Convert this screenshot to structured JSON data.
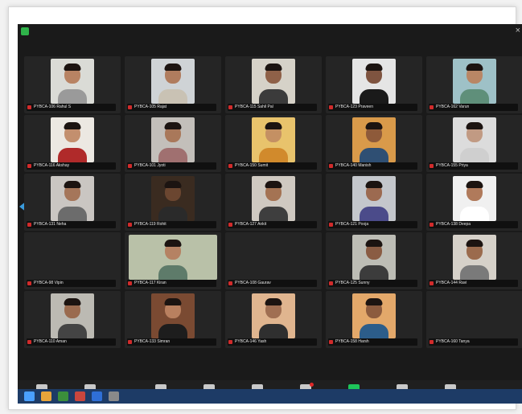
{
  "meeting": {
    "participants": [
      {
        "name": "PYBCA-106 Rahul S",
        "skin": "#b88363",
        "shirt": "#9a9a9a",
        "bg": "#dadbd6",
        "wide": false
      },
      {
        "name": "PYBCA-105 Rajat",
        "skin": "#b07c5e",
        "shirt": "#c9c2b4",
        "bg": "#cfd3d6",
        "wide": false
      },
      {
        "name": "PYBCA-115 Sahil Pal",
        "skin": "#8f6148",
        "shirt": "#3b3b3b",
        "bg": "#d6d2c8",
        "wide": false
      },
      {
        "name": "PYBCA-123 Praveen",
        "skin": "#7f5440",
        "shirt": "#1a1a1a",
        "bg": "#e5e5e5",
        "wide": false
      },
      {
        "name": "PYBCA-162 Varun",
        "skin": "#b98665",
        "shirt": "#5f8f7a",
        "bg": "#9ec1c7",
        "wide": false
      },
      {
        "name": "PYBCA-116 Akshay",
        "skin": "#c38f6e",
        "shirt": "#b02a2a",
        "bg": "#ece8e2",
        "wide": false
      },
      {
        "name": "PYBCA-101 Jyoti",
        "skin": "#a9785a",
        "shirt": "#a07070",
        "bg": "#c3bfba",
        "wide": false
      },
      {
        "name": "PYBCA-150 Sumit",
        "skin": "#c49063",
        "shirt": "#d18a2c",
        "bg": "#e8c36c",
        "wide": false
      },
      {
        "name": "PYBCA-140 Manish",
        "skin": "#8e5a3a",
        "shirt": "#2f4f73",
        "bg": "#d99a4a",
        "wide": false
      },
      {
        "name": "PYBCA-155 Priya",
        "skin": "#c19a83",
        "shirt": "#cfcfcf",
        "bg": "#dcdcdc",
        "wide": false
      },
      {
        "name": "PYBCA-131 Neha",
        "skin": "#a5765a",
        "shirt": "#6c6c6c",
        "bg": "#cac6c2",
        "wide": false
      },
      {
        "name": "PYBCA-119 Rohit",
        "skin": "#6b4630",
        "shirt": "#2a2a2a",
        "bg": "#3a2b20",
        "wide": false
      },
      {
        "name": "PYBCA-127 Ankit",
        "skin": "#a47353",
        "shirt": "#3e3e3e",
        "bg": "#cfc9c1",
        "wide": false
      },
      {
        "name": "PYBCA-121 Pooja",
        "skin": "#9c6a50",
        "shirt": "#4b4b8a",
        "bg": "#c4c7cc",
        "wide": false
      },
      {
        "name": "PYBCA-138 Deepa",
        "skin": "#b07a5b",
        "shirt": "#ffffff",
        "bg": "#f0f0f0",
        "wide": false
      },
      {
        "name": "PYBCA-98 Vipin",
        "skin": "",
        "shirt": "",
        "bg": "",
        "wide": false,
        "empty": true
      },
      {
        "name": "PYBCA-117 Kiran",
        "skin": "#b58263",
        "shirt": "#5e7b6a",
        "bg": "#b9c1a8",
        "wide": true
      },
      {
        "name": "PYBCA-108 Gaurav",
        "skin": "",
        "shirt": "",
        "bg": "",
        "wide": false,
        "empty": true
      },
      {
        "name": "PYBCA-125 Sunny",
        "skin": "#8a5c43",
        "shirt": "#3c3c3c",
        "bg": "#bdbdb5",
        "wide": false
      },
      {
        "name": "PYBCA-144 Ravi",
        "skin": "#9b6b4d",
        "shirt": "#7a7a7a",
        "bg": "#d6d1c9",
        "wide": false
      },
      {
        "name": "PYBCA-110 Aman",
        "skin": "#9a6b4f",
        "shirt": "#444",
        "bg": "#bcbab3",
        "wide": false
      },
      {
        "name": "PYBCA-133 Simran",
        "skin": "#b9805f",
        "shirt": "#1d1d1d",
        "bg": "#7a4a32",
        "wide": false
      },
      {
        "name": "PYBCA-146 Yash",
        "skin": "#a06f52",
        "shirt": "#2f2f2f",
        "bg": "#e0b58f",
        "wide": false
      },
      {
        "name": "PYBCA-158 Harsh",
        "skin": "#8c5b3e",
        "shirt": "#2c5d8a",
        "bg": "#e3a86a",
        "wide": false
      },
      {
        "name": "PYBCA-160 Tanya",
        "skin": "",
        "shirt": "",
        "bg": "",
        "wide": false,
        "empty": true
      }
    ]
  },
  "toolbar": {
    "items": [
      {
        "label": "Unmute",
        "icon": "microphone-icon"
      },
      {
        "label": "Start Video",
        "icon": "video-camera-icon"
      },
      {
        "label": "Security",
        "icon": "shield-icon"
      },
      {
        "label": "Participants",
        "icon": "participants-icon"
      },
      {
        "label": "Polls",
        "icon": "poll-icon"
      },
      {
        "label": "Chat",
        "icon": "chat-icon"
      },
      {
        "label": "Share Screen",
        "icon": "share-screen-icon"
      },
      {
        "label": "Record",
        "icon": "record-icon"
      },
      {
        "label": "Reactions",
        "icon": "reactions-icon"
      }
    ]
  },
  "colors": {
    "accent": "#1ec55a",
    "danger": "#e02828",
    "nav": "#2a8fe0"
  }
}
